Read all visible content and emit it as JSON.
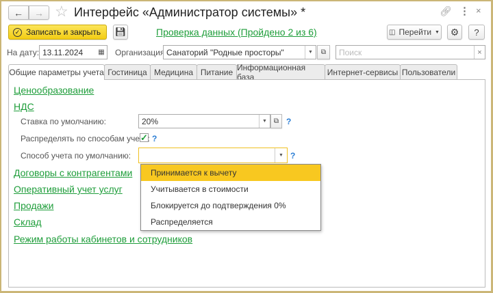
{
  "window": {
    "title": "Интерфейс «Администратор системы» *"
  },
  "toolbar": {
    "save_close": "Записать и закрыть",
    "check_link": "Проверка данных (Пройдено 2 из 6)",
    "goto": "Перейти",
    "help": "?"
  },
  "filters": {
    "date_label": "На дату:",
    "date_value": "13.11.2024",
    "org_label": "Организация:",
    "org_value": "Санаторий \"Родные просторы\"",
    "search_placeholder": "Поиск"
  },
  "tabs": [
    {
      "label": "Общие параметры учета",
      "active": true
    },
    {
      "label": "Гостиница"
    },
    {
      "label": "Медицина"
    },
    {
      "label": "Питание"
    },
    {
      "label": "Информационная база"
    },
    {
      "label": "Интернет-сервисы"
    },
    {
      "label": "Пользователи"
    }
  ],
  "sections": {
    "pricing": "Ценообразование",
    "vat": "НДС",
    "contracts": "Договоры с контрагентами",
    "ops": "Оперативный учет услуг",
    "sales": "Продажи",
    "warehouse": "Склад",
    "schedule": "Режим работы кабинетов и сотрудников"
  },
  "vat": {
    "rate_label": "Ставка по умолчанию:",
    "rate_value": "20%",
    "distribute_label": "Распределять по способам учета:",
    "distribute_checked": true,
    "method_label": "Способ учета по умолчанию:",
    "method_value": "",
    "help": "?"
  },
  "dropdown": {
    "items": [
      "Принимается к вычету",
      "Учитывается в стоимости",
      "Блокируется до подтверждения 0%",
      "Распределяется"
    ],
    "selected": 0
  },
  "colors": {
    "accent": "#f8c820",
    "link": "#1e9d3a",
    "border": "#cbb677"
  }
}
